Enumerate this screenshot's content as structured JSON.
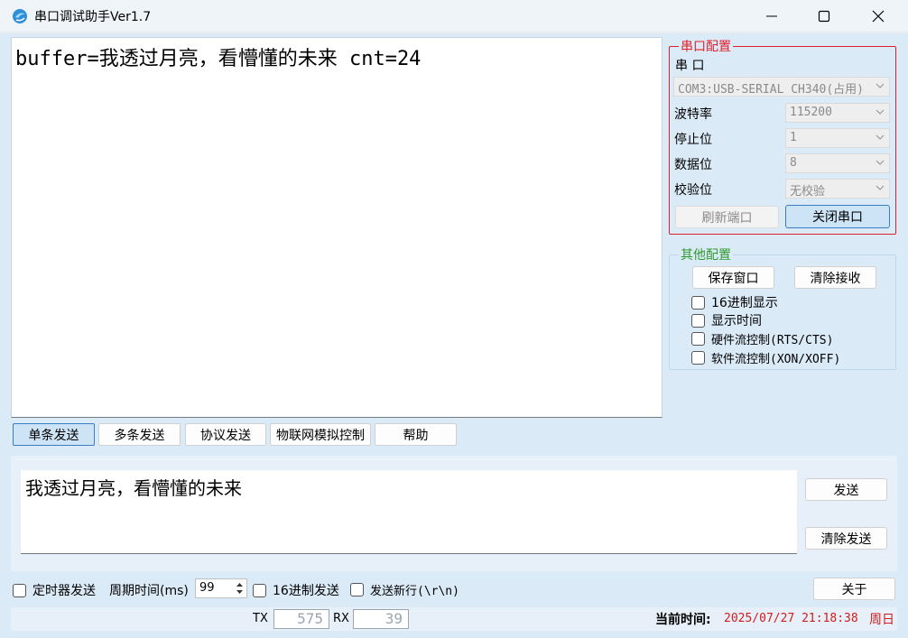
{
  "window": {
    "title": "串口调试助手Ver1.7",
    "icon": "app-logo-icon"
  },
  "receive": {
    "text": "buffer=我透过月亮，看懵懂的未来 cnt=24"
  },
  "port_config": {
    "legend": "串口配置",
    "port_label": "串  口",
    "port_value": "COM3:USB-SERIAL CH340(占用)",
    "baud_label": "波特率",
    "baud_value": "115200",
    "stop_label": "停止位",
    "stop_value": "1",
    "data_label": "数据位",
    "data_value": "8",
    "parity_label": "校验位",
    "parity_value": "无校验",
    "refresh_label": "刷新端口",
    "close_label": "关闭串口"
  },
  "other_config": {
    "legend": "其他配置",
    "save_label": "保存窗口",
    "clear_label": "清除接收",
    "hex_display": "16进制显示",
    "show_time": "显示时间",
    "hw_flow": "硬件流控制(RTS/CTS)",
    "sw_flow": "软件流控制(XON/XOFF)"
  },
  "tabs": [
    {
      "label": "单条发送",
      "active": true
    },
    {
      "label": "多条发送",
      "active": false
    },
    {
      "label": "协议发送",
      "active": false
    },
    {
      "label": "物联网模拟控制",
      "active": false
    },
    {
      "label": "帮助",
      "active": false
    }
  ],
  "send": {
    "text": "我透过月亮，看懵懂的未来",
    "send_label": "发送",
    "clear_label": "清除发送"
  },
  "options": {
    "timer_send": "定时器发送",
    "period_label": "周期时间(ms)",
    "period_value": "99",
    "hex_send": "16进制发送",
    "newline": "发送新行(\\r\\n)",
    "about_label": "关于"
  },
  "status": {
    "tx_label": "TX",
    "tx_value": "575",
    "rx_label": "RX",
    "rx_value": "39",
    "time_label": "当前时间:",
    "time_value": "2025/07/27 21:18:38",
    "weekday": "周日"
  },
  "colors": {
    "accent_red": "#e0202a",
    "legend_green": "#2f9b2f",
    "clock_red": "#d01c1c",
    "panel_bg": "#dbeaf7"
  }
}
